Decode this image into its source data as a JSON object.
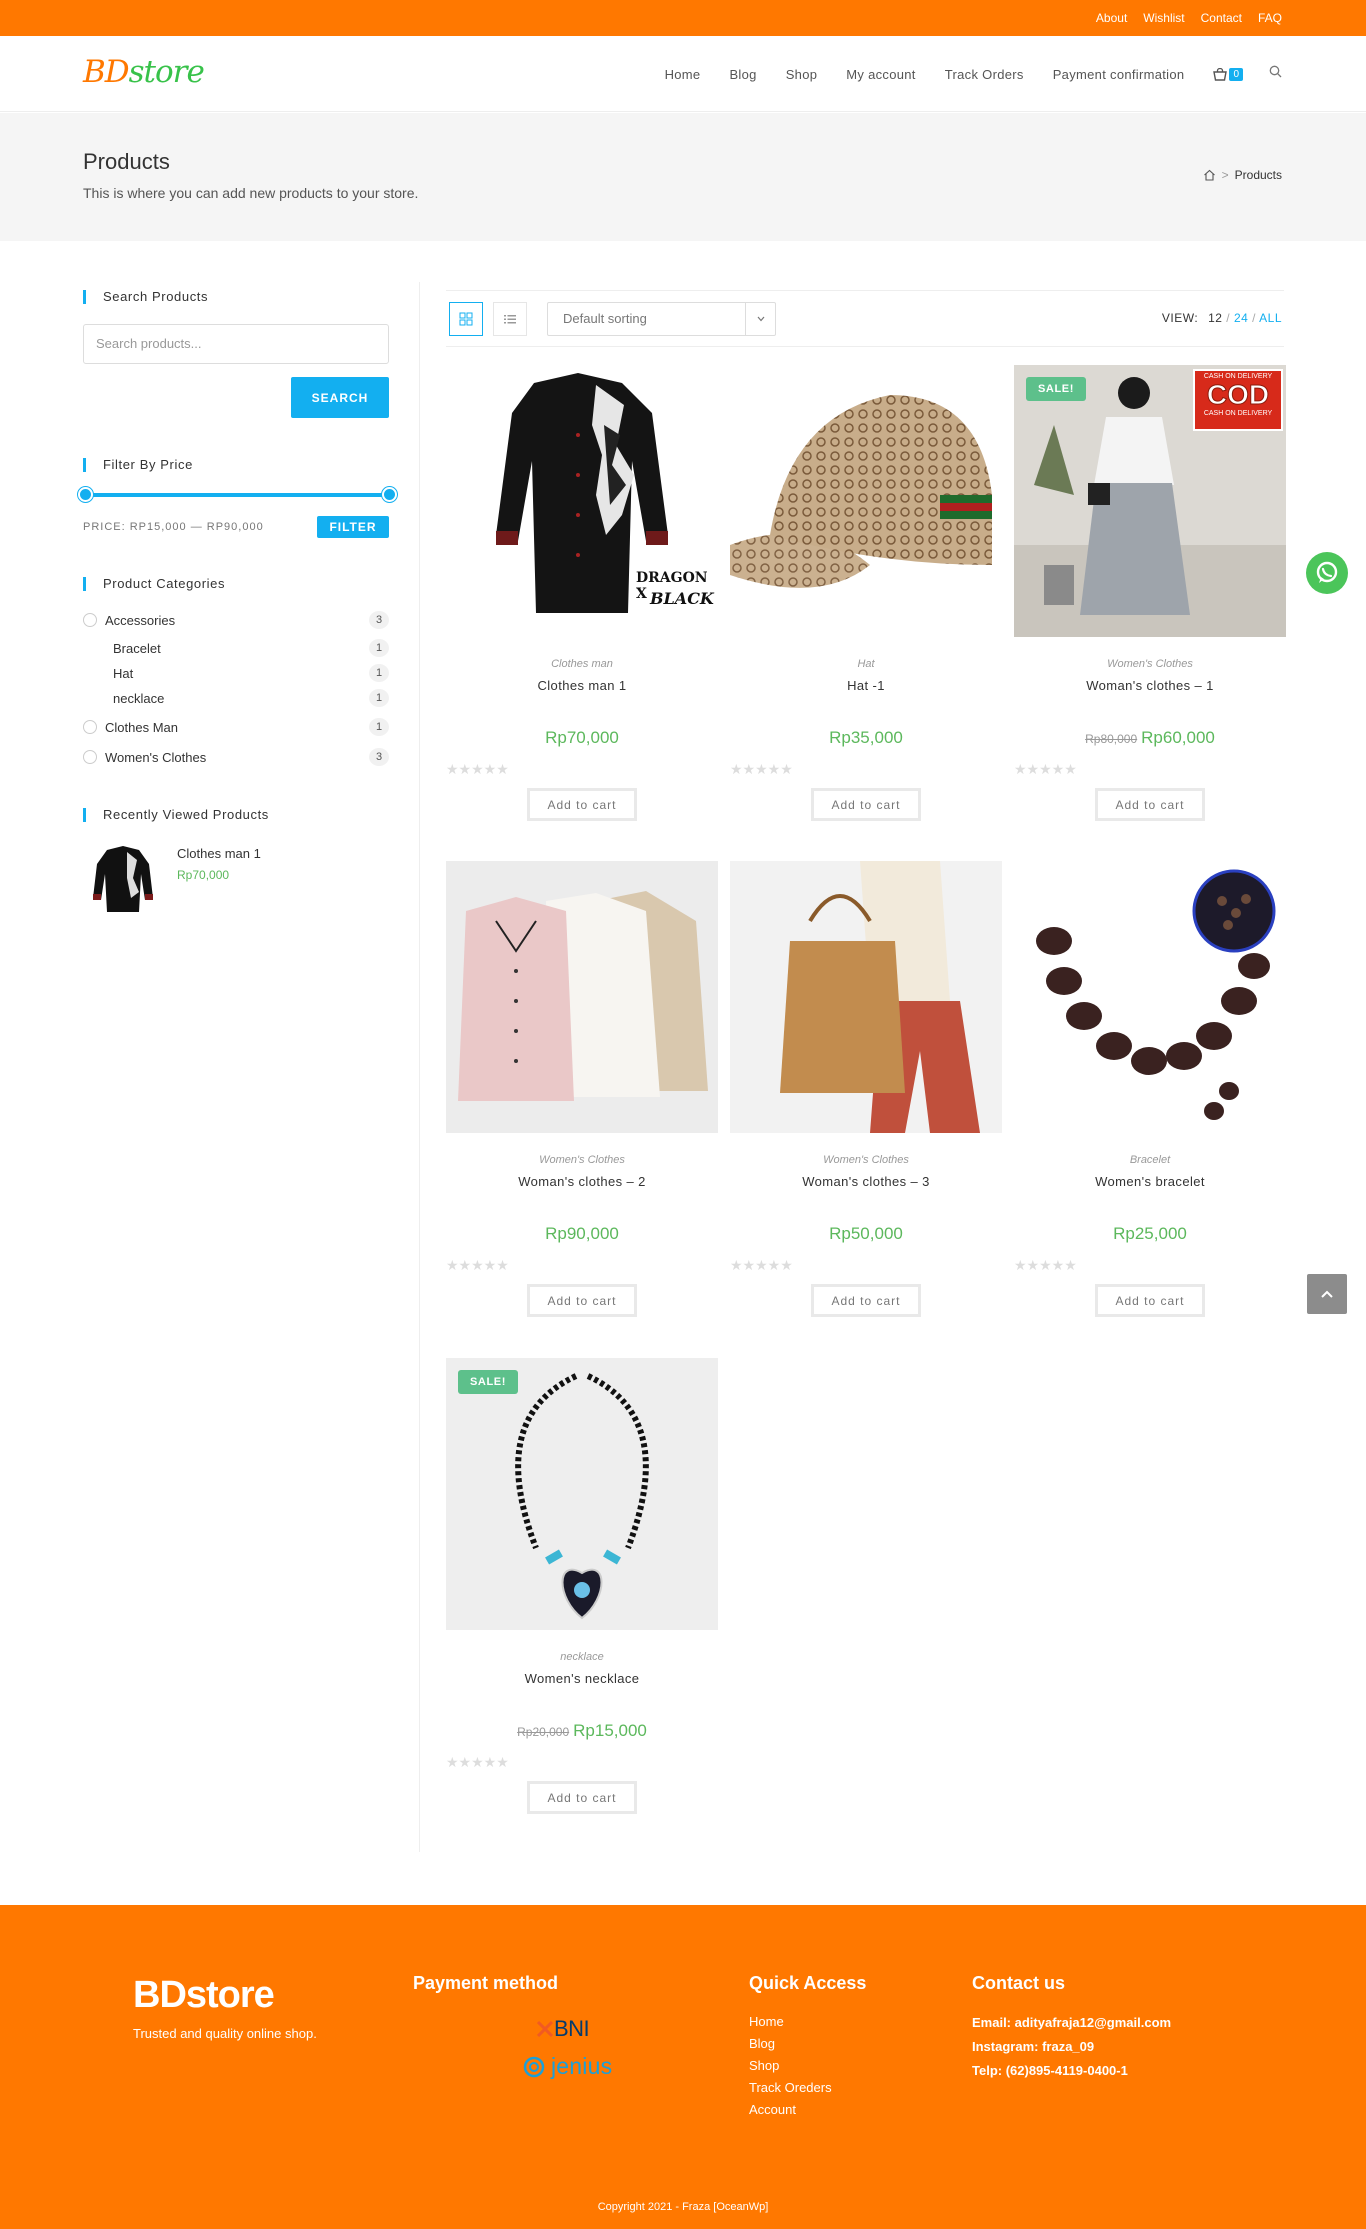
{
  "topbar": {
    "links": [
      "About",
      "Wishlist",
      "Contact",
      "FAQ"
    ]
  },
  "header": {
    "logo_a": "BD",
    "logo_b": "store",
    "nav": [
      "Home",
      "Blog",
      "Shop",
      "My account",
      "Track Orders",
      "Payment confirmation"
    ],
    "cart_count": "0"
  },
  "page_header": {
    "title": "Products",
    "subtitle": "This is where you can add new products to your store.",
    "breadcrumb_current": "Products"
  },
  "sidebar": {
    "search": {
      "title": "Search Products",
      "placeholder": "Search products...",
      "button": "SEARCH"
    },
    "price_filter": {
      "title": "Filter By Price",
      "label": "PRICE: RP15,000 — RP90,000",
      "button": "FILTER",
      "min": 15000,
      "max": 90000
    },
    "categories": {
      "title": "Product Categories",
      "items": [
        {
          "label": "Accessories",
          "count": "3",
          "level": 0
        },
        {
          "label": "Bracelet",
          "count": "1",
          "level": 1
        },
        {
          "label": "Hat",
          "count": "1",
          "level": 1
        },
        {
          "label": "necklace",
          "count": "1",
          "level": 1
        },
        {
          "label": "Clothes Man",
          "count": "1",
          "level": 0
        },
        {
          "label": "Women's Clothes",
          "count": "3",
          "level": 0
        }
      ]
    },
    "recently_viewed": {
      "title": "Recently Viewed Products",
      "name": "Clothes man 1",
      "price": "Rp70,000"
    }
  },
  "toolbar": {
    "sort": "Default sorting",
    "view_label": "VIEW:",
    "view_active": "12",
    "view_24": "24",
    "view_all": "ALL"
  },
  "products": [
    {
      "category": "Clothes man",
      "name": "Clothes man 1",
      "price": "Rp70,000",
      "old_price": "",
      "sale": false,
      "button": "Add to cart",
      "image_text_1": "DRAGON X",
      "image_text_2": "BLACK"
    },
    {
      "category": "Hat",
      "name": "Hat -1",
      "price": "Rp35,000",
      "old_price": "",
      "sale": false,
      "button": "Add to cart"
    },
    {
      "category": "Women's Clothes",
      "name": "Woman's clothes – 1",
      "price": "Rp60,000",
      "old_price": "Rp80,000",
      "sale": true,
      "sale_label": "SALE!",
      "button": "Add to cart",
      "cod_top": "CASH ON DELIVERY",
      "cod_main": "COD",
      "cod_bottom": "CASH ON DELIVERY"
    },
    {
      "category": "Women's Clothes",
      "name": "Woman's clothes – 2",
      "price": "Rp90,000",
      "old_price": "",
      "sale": false,
      "button": "Add to cart"
    },
    {
      "category": "Women's Clothes",
      "name": "Woman's clothes – 3",
      "price": "Rp50,000",
      "old_price": "",
      "sale": false,
      "button": "Add to cart"
    },
    {
      "category": "Bracelet",
      "name": "Women's bracelet",
      "price": "Rp25,000",
      "old_price": "",
      "sale": false,
      "button": "Add to cart"
    },
    {
      "category": "necklace",
      "name": "Women's necklace",
      "price": "Rp15,000",
      "old_price": "Rp20,000",
      "sale": true,
      "sale_label": "SALE!",
      "button": "Add to cart"
    }
  ],
  "footer": {
    "logo": "BDstore",
    "tagline": "Trusted and quality online shop.",
    "payment_title": "Payment method",
    "bni": "BNI",
    "jenius": "jenius",
    "quick_title": "Quick Access",
    "quick_links": [
      "Home",
      "Blog",
      "Shop",
      "Track Oreders",
      "Account"
    ],
    "contact_title": "Contact us",
    "email": "Email: adityafraja12@gmail.com",
    "instagram": "Instagram: fraza_09",
    "phone": "Telp: (62)895-4119-0400-1",
    "copyright": "Copyright 2021 - Fraza [OceanWp]"
  },
  "colors": {
    "brand_orange": "#ff7800",
    "accent_blue": "#13aff0",
    "price_green": "#5cb85c",
    "sale_green": "#5dc08b"
  }
}
